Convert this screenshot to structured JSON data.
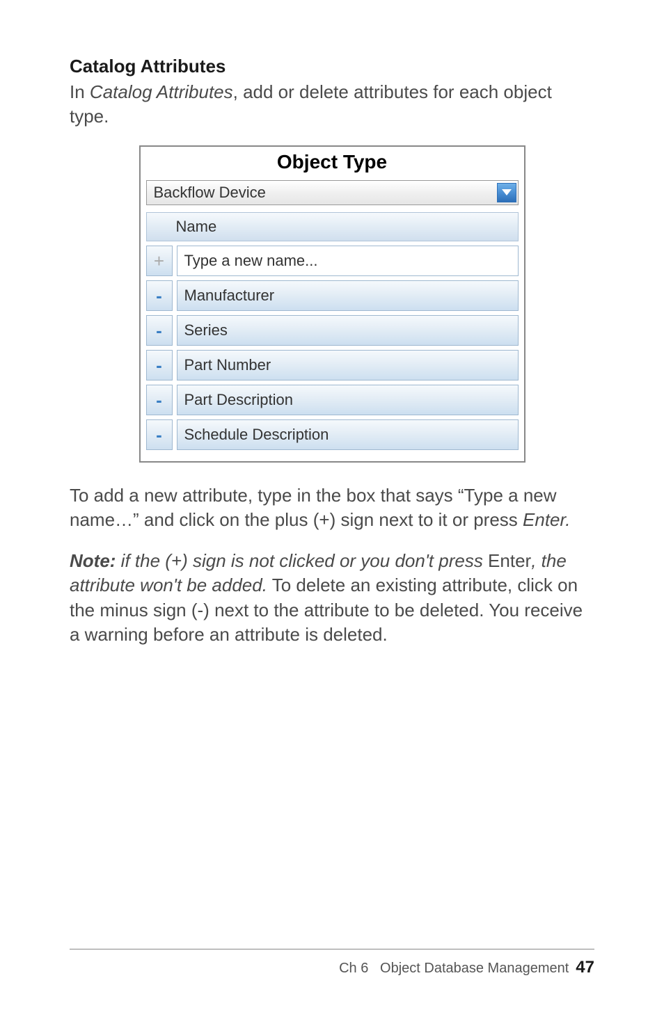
{
  "heading": "Catalog Attributes",
  "intro_pre": "In ",
  "intro_em": "Catalog Attributes",
  "intro_post": ", add or delete attributes for each object type.",
  "panel": {
    "title": "Object Type",
    "dropdown_value": "Backflow Device",
    "column_header": "Name",
    "new_row": {
      "placeholder": "Type a new name...",
      "button_symbol": "+"
    },
    "attributes": [
      {
        "name": "Manufacturer",
        "button_symbol": "-"
      },
      {
        "name": "Series",
        "button_symbol": "-"
      },
      {
        "name": "Part Number",
        "button_symbol": "-"
      },
      {
        "name": "Part Description",
        "button_symbol": "-"
      },
      {
        "name": "Schedule Description",
        "button_symbol": "-"
      }
    ]
  },
  "para2_pre": "To add a new attribute, type in the box that says “Type a new name…” and click on the plus (+) sign next to it or press ",
  "para2_em": "Enter.",
  "note_label": "Note:",
  "note_italic": " if the (+) sign is not clicked or you don't press ",
  "note_roman_interjection": "Enter",
  "note_italic2": ", the attribute won't be added.",
  "note_rest": " To delete an existing attribute, click on the minus sign (-) next to the attribute to be deleted. You receive a warning before an attribute is deleted.",
  "footer": {
    "chapter": "Ch 6",
    "title": "Object Database Management",
    "page": "47"
  }
}
